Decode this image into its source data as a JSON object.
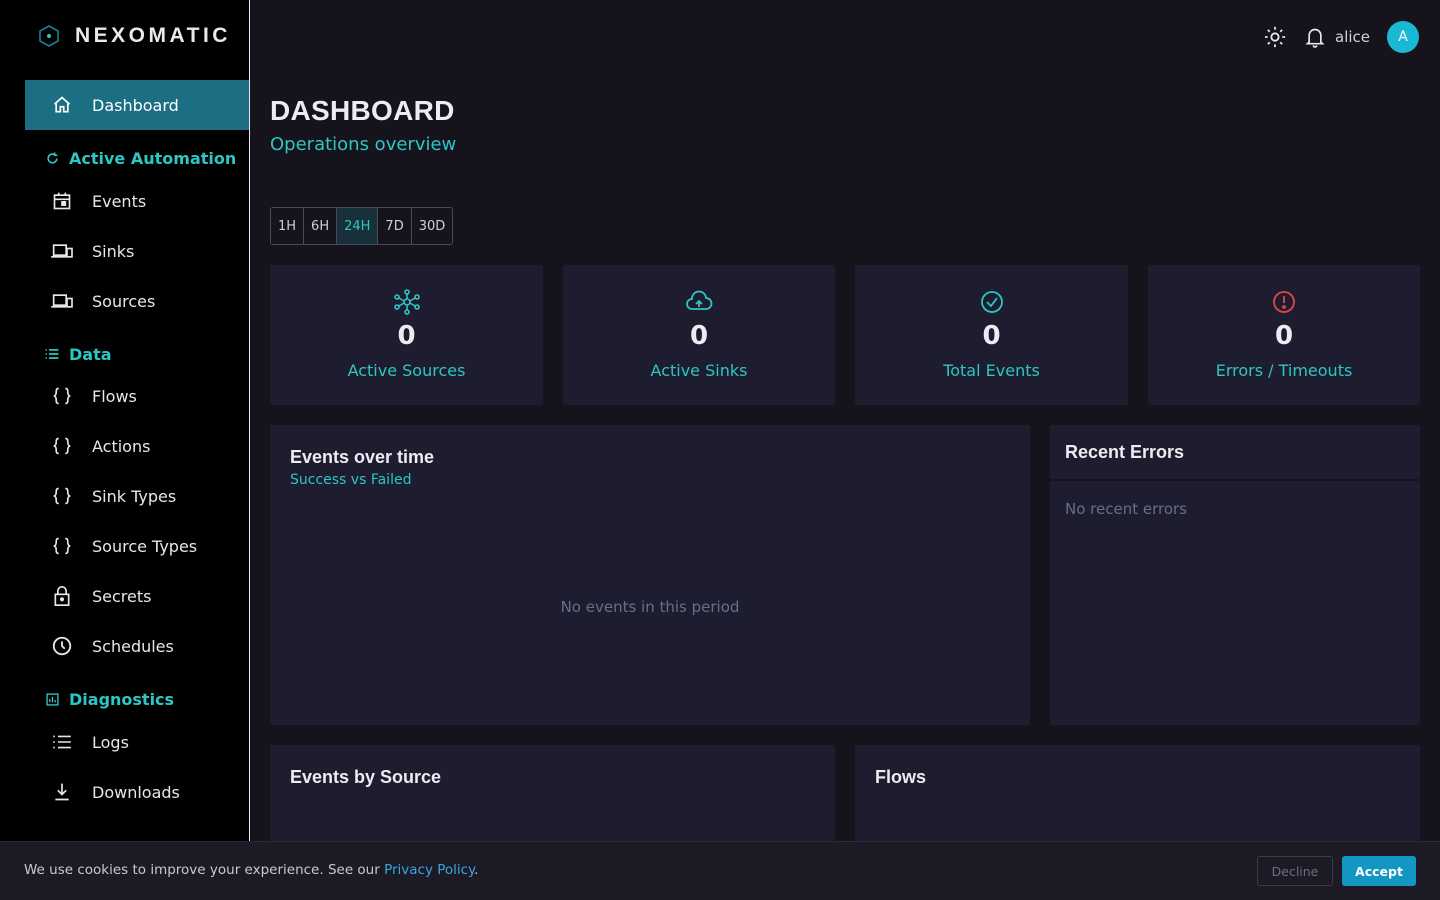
{
  "brand": {
    "name": "NEXOMATIC",
    "icon": "hexagon-logo-icon"
  },
  "sidebar": {
    "dashboard": {
      "label": "Dashboard",
      "icon": "home-icon"
    },
    "sections": {
      "automation": {
        "label": "Active Automation",
        "icon": "refresh-icon"
      },
      "data": {
        "label": "Data",
        "icon": "list-icon"
      },
      "diagnostics": {
        "label": "Diagnostics",
        "icon": "chart-icon"
      }
    },
    "items": {
      "events": {
        "label": "Events",
        "icon": "calendar-icon"
      },
      "sinks": {
        "label": "Sinks",
        "icon": "devices-icon"
      },
      "sources": {
        "label": "Sources",
        "icon": "devices-icon"
      },
      "flows": {
        "label": "Flows",
        "icon": "braces-icon"
      },
      "actions": {
        "label": "Actions",
        "icon": "braces-icon"
      },
      "sink_types": {
        "label": "Sink Types",
        "icon": "braces-icon"
      },
      "source_types": {
        "label": "Source Types",
        "icon": "braces-icon"
      },
      "secrets": {
        "label": "Secrets",
        "icon": "lock-icon"
      },
      "schedules": {
        "label": "Schedules",
        "icon": "clock-icon"
      },
      "logs": {
        "label": "Logs",
        "icon": "list-icon"
      },
      "downloads": {
        "label": "Downloads",
        "icon": "download-icon"
      }
    }
  },
  "topbar": {
    "username": "alice",
    "avatar_initial": "A"
  },
  "page": {
    "title": "DASHBOARD",
    "subtitle": "Operations overview"
  },
  "ranges": [
    "1H",
    "6H",
    "24H",
    "7D",
    "30D"
  ],
  "active_range": "24H",
  "stats": {
    "active_sources": {
      "value": "0",
      "label": "Active Sources",
      "icon": "network-icon"
    },
    "active_sinks": {
      "value": "0",
      "label": "Active Sinks",
      "icon": "cloud-upload-icon"
    },
    "total_events": {
      "value": "0",
      "label": "Total Events",
      "icon": "check-circle-icon"
    },
    "errors": {
      "value": "0",
      "label": "Errors / Timeouts",
      "icon": "alert-circle-icon"
    }
  },
  "panels": {
    "events_over_time": {
      "title": "Events over time",
      "subtitle": "Success vs Failed",
      "empty": "No events in this period"
    },
    "recent_errors": {
      "title": "Recent Errors",
      "empty": "No recent errors"
    },
    "events_by_source": {
      "title": "Events by Source"
    },
    "flows": {
      "title": "Flows"
    }
  },
  "cookie": {
    "text": "We use cookies to improve your experience. See our",
    "link": "Privacy Policy",
    "suffix": ".",
    "decline": "Decline",
    "accept": "Accept"
  },
  "colors": {
    "accent": "#2cc6c3",
    "active_nav": "#1c6f82",
    "error": "#e0474c",
    "card": "#1e1d30",
    "primary_button": "#1397c2"
  }
}
